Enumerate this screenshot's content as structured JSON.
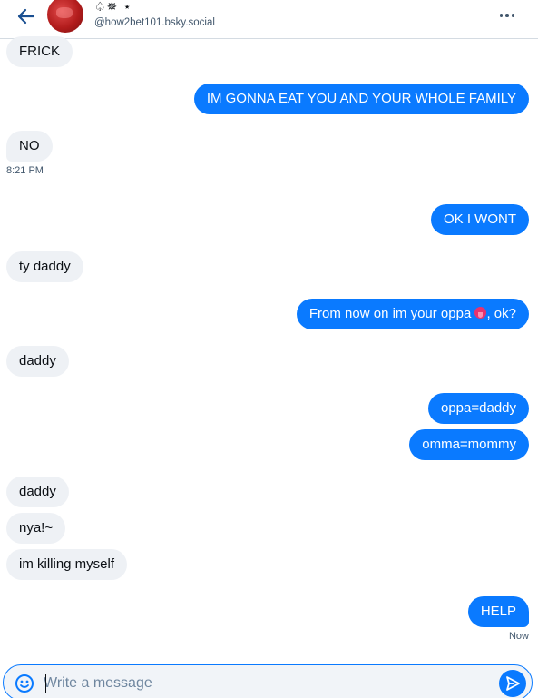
{
  "header": {
    "display_name": "♤✵ ⋆",
    "handle": "@how2bet101.bsky.social"
  },
  "messages": [
    {
      "dir": "in",
      "text": "FRICK"
    },
    {
      "dir": "out",
      "text": "IM GONNA EAT YOU AND YOUR WHOLE FAMILY"
    },
    {
      "dir": "in",
      "text": "NO",
      "time": "8:21 PM"
    },
    {
      "dir": "out",
      "text": "OK I WONT"
    },
    {
      "dir": "in",
      "text": "ty daddy"
    },
    {
      "dir": "out",
      "text_before": "From now on im your oppa ",
      "emoji": "tongue-emoji",
      "text_after": ", ok?"
    },
    {
      "dir": "in",
      "text": "daddy"
    },
    {
      "dir": "out",
      "text": "oppa=daddy"
    },
    {
      "dir": "out",
      "text": "omma=mommy"
    },
    {
      "dir": "in",
      "text": "daddy"
    },
    {
      "dir": "in",
      "text": "nya!~"
    },
    {
      "dir": "in",
      "text": "im killing myself"
    },
    {
      "dir": "out",
      "text": "HELP",
      "time": "Now"
    }
  ],
  "composer": {
    "placeholder": "Write a message"
  },
  "colors": {
    "accent": "#0a7aff",
    "incoming_bubble": "#eef1f5",
    "muted_text": "#42576c"
  },
  "icons": {
    "back": "arrow-left-icon",
    "more": "ellipsis-icon",
    "emoji": "smiley-icon",
    "send": "paper-plane-icon"
  }
}
